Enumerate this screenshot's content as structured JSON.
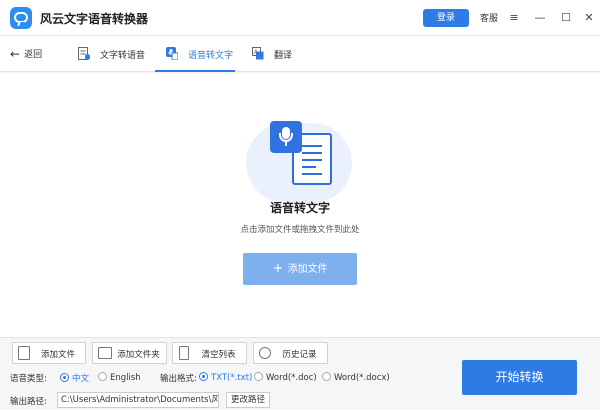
{
  "app": {
    "title": "风云文字语音转换器",
    "login_label": "登录",
    "support_label": "客服",
    "menu_glyph": "≡",
    "minimize_glyph": "—",
    "maximize_glyph": "☐",
    "close_glyph": "✕"
  },
  "nav": {
    "back_label": "返回",
    "tabs": [
      {
        "label": "文字转语音",
        "icon": "text-to-speech-icon",
        "active": false
      },
      {
        "label": "语音转文字",
        "icon": "microphone-icon",
        "active": true
      },
      {
        "label": "翻译",
        "icon": "translate-icon",
        "active": false
      }
    ]
  },
  "main": {
    "title": "语音转文字",
    "subtitle": "点击添加文件或拖拽文件到此处",
    "add_file_label": "添加文件"
  },
  "toolbar": {
    "buttons": [
      {
        "label": "添加文件",
        "icon": "add-file-icon"
      },
      {
        "label": "添加文件夹",
        "icon": "add-folder-icon"
      },
      {
        "label": "清空列表",
        "icon": "trash-icon"
      },
      {
        "label": "历史记录",
        "icon": "history-icon"
      }
    ]
  },
  "options": {
    "voice_type_label": "语音类型:",
    "voice_types": [
      {
        "label": "中文",
        "selected": true
      },
      {
        "label": "English",
        "selected": false
      }
    ],
    "output_format_label": "输出格式:",
    "output_formats": [
      {
        "label": "TXT(*.txt)",
        "selected": true
      },
      {
        "label": "Word(*.doc)",
        "selected": false
      },
      {
        "label": "Word(*.docx)",
        "selected": false
      }
    ],
    "output_path_label": "输出路径:",
    "output_path_value": "C:\\Users\\Administrator\\Documents\\风云文",
    "change_path_label": "更改路径"
  },
  "actions": {
    "start_label": "开始转换"
  },
  "colors": {
    "accent": "#2f7be5",
    "add_file_button": "#7eb0ee"
  }
}
